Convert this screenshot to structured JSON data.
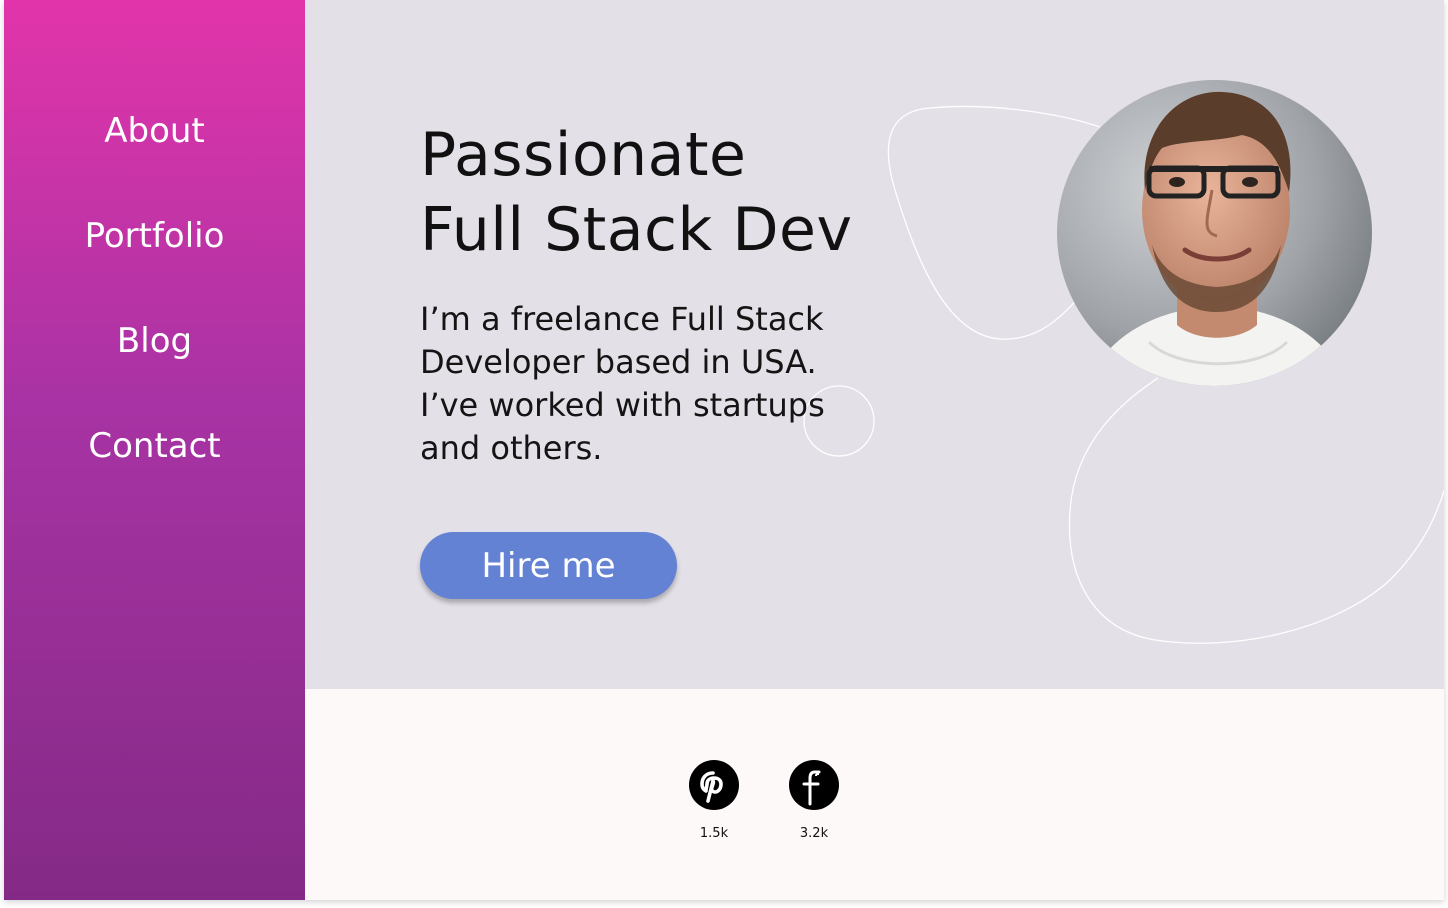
{
  "nav": {
    "items": [
      {
        "label": "About"
      },
      {
        "label": "Portfolio"
      },
      {
        "label": "Blog"
      },
      {
        "label": "Contact"
      }
    ]
  },
  "hero": {
    "headline_lines": [
      "Passionate",
      "Full Stack Dev"
    ],
    "intro_lines": [
      "I’m a freelance Full Stack",
      "Developer based in USA.",
      "I’ve worked with startups",
      "and others."
    ],
    "cta_label": "Hire me"
  },
  "social": [
    {
      "icon": "pinterest-icon",
      "count": "1.5k"
    },
    {
      "icon": "facebook-icon",
      "count": "3.2k"
    }
  ],
  "colors": {
    "sidebar_top": "#e234aa",
    "sidebar_bottom": "#842a86",
    "hero_background": "#e3e0e7",
    "footer_background": "#fdf9f9",
    "cta_background": "#6482d4"
  }
}
